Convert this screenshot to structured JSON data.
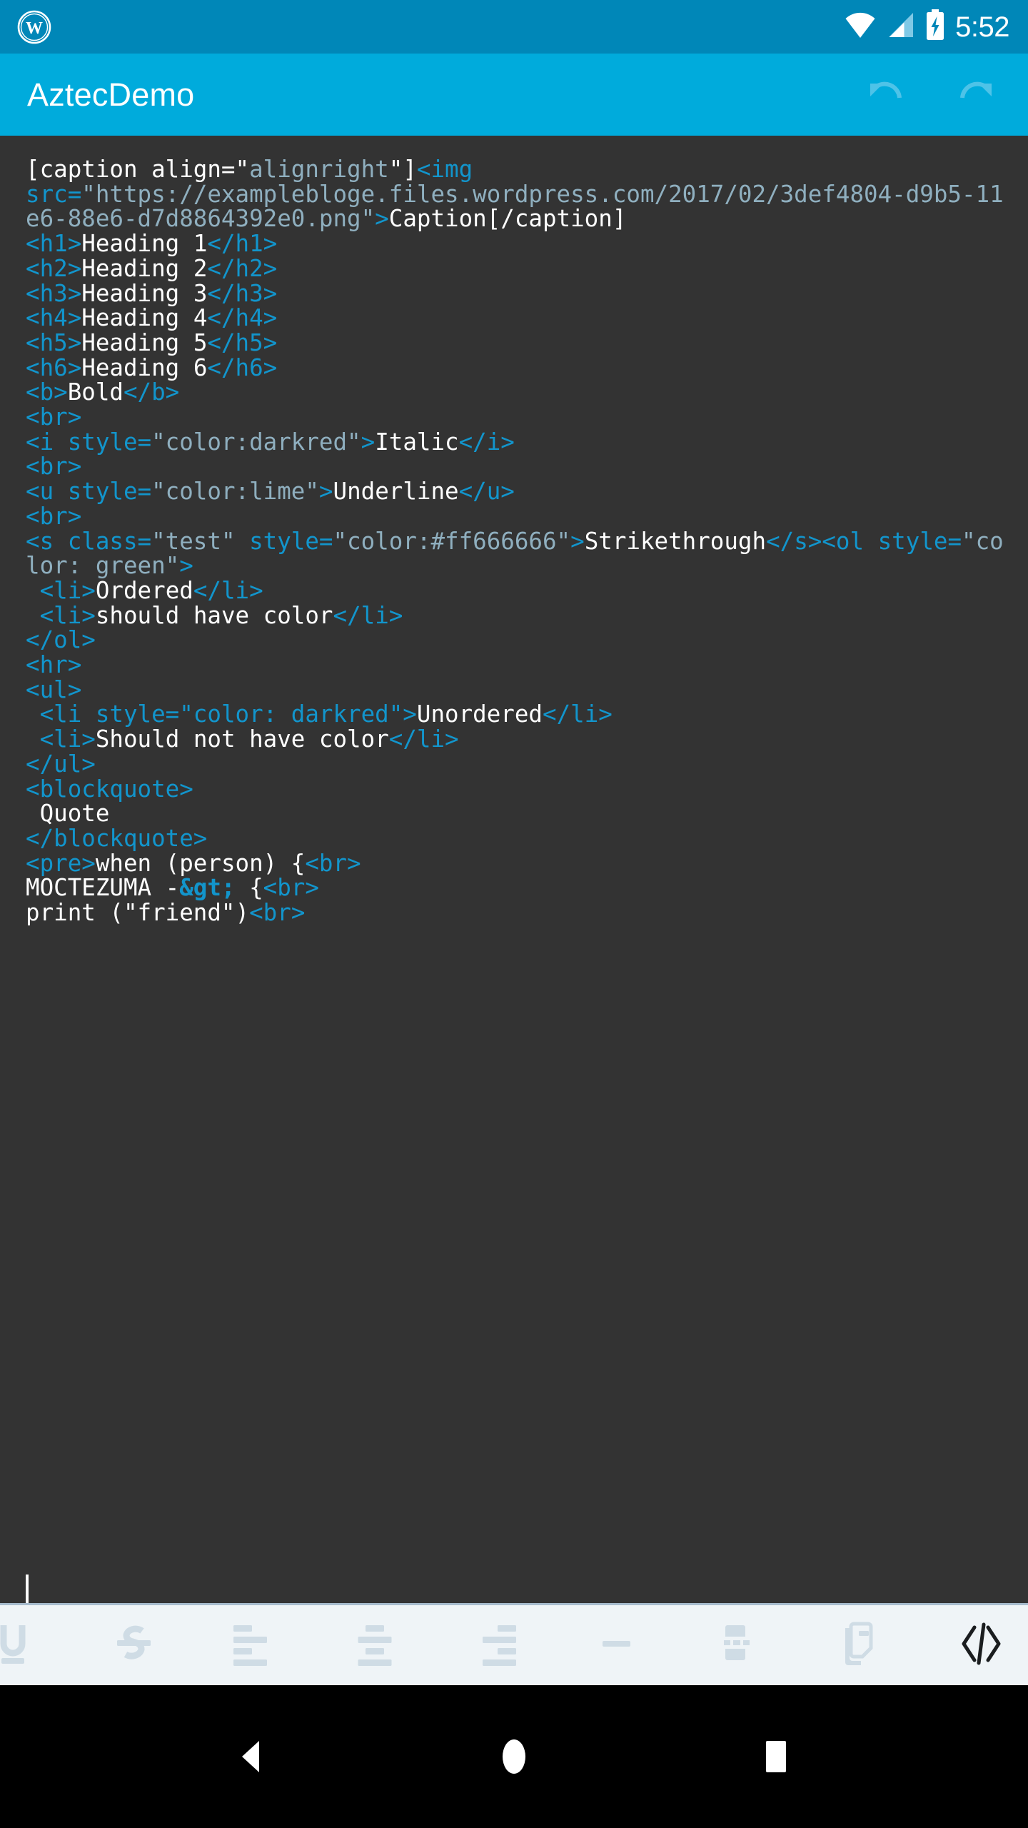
{
  "statusbar": {
    "app_icon": "wordpress-logo-icon",
    "wifi_icon": "wifi-icon",
    "cellular_icon": "cellular-signal-icon",
    "battery_icon": "battery-charging-icon",
    "clock": "5:52"
  },
  "appbar": {
    "title": "AztecDemo",
    "undo_label": "Undo",
    "redo_label": "Redo",
    "background_color": "#00ABDC",
    "title_color": "#FFFFFF"
  },
  "editor": {
    "background_color": "#333333",
    "text_color": "#FFFFFF",
    "tag_color": "#1295CC",
    "attribute_value_color": "#8FAFBF",
    "lines": [
      [
        {
          "t": "txt",
          "s": "[caption align="
        },
        {
          "t": "txt",
          "s": "\""
        },
        {
          "t": "attrval",
          "s": "alignright"
        },
        {
          "t": "txt",
          "s": "\"]"
        },
        {
          "t": "tag",
          "s": "<img"
        }
      ],
      [
        {
          "t": "tag",
          "s": "src="
        },
        {
          "t": "attrval",
          "s": "\"https://examplebloge.files.wordpress.com/2017/02/3def4804-d9b5-11e6-88e6-d7d8864392e0.png\""
        },
        {
          "t": "tag",
          "s": ">"
        },
        {
          "t": "txt",
          "s": "Caption[/caption]"
        }
      ],
      [
        {
          "t": "tag",
          "s": "<h1>"
        },
        {
          "t": "txt",
          "s": "Heading 1"
        },
        {
          "t": "tag",
          "s": "</h1>"
        }
      ],
      [
        {
          "t": "tag",
          "s": "<h2>"
        },
        {
          "t": "txt",
          "s": "Heading 2"
        },
        {
          "t": "tag",
          "s": "</h2>"
        }
      ],
      [
        {
          "t": "tag",
          "s": "<h3>"
        },
        {
          "t": "txt",
          "s": "Heading 3"
        },
        {
          "t": "tag",
          "s": "</h3>"
        }
      ],
      [
        {
          "t": "tag",
          "s": "<h4>"
        },
        {
          "t": "txt",
          "s": "Heading 4"
        },
        {
          "t": "tag",
          "s": "</h4>"
        }
      ],
      [
        {
          "t": "tag",
          "s": "<h5>"
        },
        {
          "t": "txt",
          "s": "Heading 5"
        },
        {
          "t": "tag",
          "s": "</h5>"
        }
      ],
      [
        {
          "t": "tag",
          "s": "<h6>"
        },
        {
          "t": "txt",
          "s": "Heading 6"
        },
        {
          "t": "tag",
          "s": "</h6>"
        }
      ],
      [
        {
          "t": "tag",
          "s": "<b>"
        },
        {
          "t": "txt",
          "s": "Bold"
        },
        {
          "t": "tag",
          "s": "</b>"
        }
      ],
      [
        {
          "t": "tag",
          "s": "<br>"
        }
      ],
      [
        {
          "t": "tag",
          "s": "<i style="
        },
        {
          "t": "attrval",
          "s": "\"color:darkred\""
        },
        {
          "t": "tag",
          "s": ">"
        },
        {
          "t": "txt",
          "s": "Italic"
        },
        {
          "t": "tag",
          "s": "</i>"
        }
      ],
      [
        {
          "t": "tag",
          "s": "<br>"
        }
      ],
      [
        {
          "t": "tag",
          "s": "<u style="
        },
        {
          "t": "attrval",
          "s": "\"color:lime\""
        },
        {
          "t": "tag",
          "s": ">"
        },
        {
          "t": "txt",
          "s": "Underline"
        },
        {
          "t": "tag",
          "s": "</u>"
        }
      ],
      [
        {
          "t": "tag",
          "s": "<br>"
        }
      ],
      [
        {
          "t": "tag",
          "s": "<s class="
        },
        {
          "t": "attrval",
          "s": "\"test\""
        },
        {
          "t": "tag",
          "s": " style="
        },
        {
          "t": "attrval",
          "s": "\"color:#ff666666\""
        },
        {
          "t": "tag",
          "s": ">"
        },
        {
          "t": "txt",
          "s": "Strikethrough"
        },
        {
          "t": "tag",
          "s": "</s><ol"
        },
        {
          "t": "tag",
          "s": " style="
        },
        {
          "t": "attrval",
          "s": "\"color: green\""
        },
        {
          "t": "tag",
          "s": ">"
        }
      ],
      [
        {
          "t": "txt",
          "s": " "
        },
        {
          "t": "tag",
          "s": "<li>"
        },
        {
          "t": "txt",
          "s": "Ordered"
        },
        {
          "t": "tag",
          "s": "</li>"
        }
      ],
      [
        {
          "t": "txt",
          "s": " "
        },
        {
          "t": "tag",
          "s": "<li>"
        },
        {
          "t": "txt",
          "s": "should have color"
        },
        {
          "t": "tag",
          "s": "</li>"
        }
      ],
      [
        {
          "t": "tag",
          "s": "</ol>"
        }
      ],
      [
        {
          "t": "tag",
          "s": "<hr>"
        }
      ],
      [
        {
          "t": "tag",
          "s": "<ul>"
        }
      ],
      [
        {
          "t": "txt",
          "s": " "
        },
        {
          "t": "tag",
          "s": "<li style=\"color: darkred\">"
        },
        {
          "t": "txt",
          "s": "Unordered"
        },
        {
          "t": "tag",
          "s": "</li>"
        }
      ],
      [
        {
          "t": "txt",
          "s": " "
        },
        {
          "t": "tag",
          "s": "<li>"
        },
        {
          "t": "txt",
          "s": "Should not have color"
        },
        {
          "t": "tag",
          "s": "</li>"
        }
      ],
      [
        {
          "t": "tag",
          "s": "</ul>"
        }
      ],
      [
        {
          "t": "tag",
          "s": "<blockquote>"
        }
      ],
      [
        {
          "t": "txt",
          "s": " Quote"
        }
      ],
      [
        {
          "t": "tag",
          "s": "</blockquote>"
        }
      ],
      [
        {
          "t": "tag",
          "s": "<pre>"
        },
        {
          "t": "txt",
          "s": "when (person) {"
        },
        {
          "t": "tag",
          "s": "<br>"
        }
      ],
      [
        {
          "t": "txt",
          "s": "MOCTEZUMA -"
        },
        {
          "t": "ent",
          "s": "&gt;"
        },
        {
          "t": "txt",
          "s": " {"
        },
        {
          "t": "tag",
          "s": "<br>"
        }
      ],
      [
        {
          "t": "txt",
          "s": "print (\"friend\")"
        },
        {
          "t": "tag",
          "s": "<br>"
        }
      ]
    ]
  },
  "format_toolbar": {
    "background_color": "#EFF4F7",
    "icon_color": "#CFDCE5",
    "active_icon_color": "#1A1D1F",
    "buttons": [
      {
        "name": "underline-icon",
        "label": "Underline",
        "active": false
      },
      {
        "name": "strikethrough-icon",
        "label": "Strikethrough",
        "active": false
      },
      {
        "name": "align-left-icon",
        "label": "Align left",
        "active": false
      },
      {
        "name": "align-center-icon",
        "label": "Align center",
        "active": false
      },
      {
        "name": "align-right-icon",
        "label": "Align right",
        "active": false
      },
      {
        "name": "horizontal-rule-icon",
        "label": "Horizontal rule",
        "active": false
      },
      {
        "name": "page-break-icon",
        "label": "Page break",
        "active": false
      },
      {
        "name": "more-tag-icon",
        "label": "More tag",
        "active": false
      },
      {
        "name": "html-code-icon",
        "label": "HTML mode",
        "active": true
      }
    ]
  },
  "navbar": {
    "background_color": "#000000",
    "back_label": "Back",
    "home_label": "Home",
    "recents_label": "Recents"
  }
}
